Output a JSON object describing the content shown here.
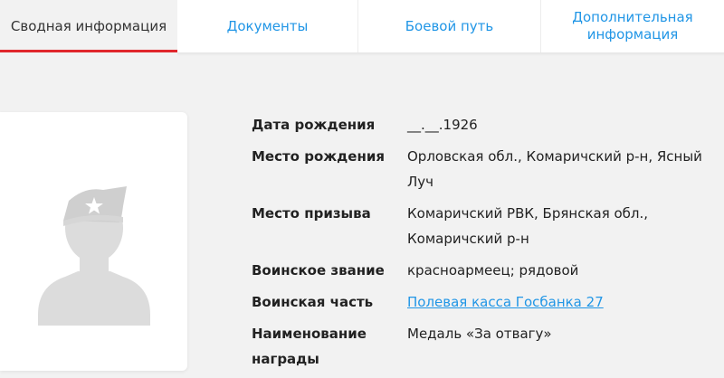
{
  "tabs": [
    {
      "label": "Сводная информация"
    },
    {
      "label": "Документы"
    },
    {
      "label": "Боевой путь"
    },
    {
      "label": "Дополнительная информация"
    }
  ],
  "person": {
    "fields": [
      {
        "label": "Дата рождения",
        "value": "__.__.1926"
      },
      {
        "label": "Место рождения",
        "value": "Орловская обл., Комаричский р-н, Ясный Луч"
      },
      {
        "label": "Место призыва",
        "value": "Комаричский РВК, Брянская обл., Комаричский р-н"
      },
      {
        "label": "Воинское звание",
        "value": "красноармеец; рядовой"
      },
      {
        "label": "Воинская часть",
        "value": "Полевая касса Госбанка 27"
      },
      {
        "label": "Наименование награды",
        "value": "Медаль «За отвагу»"
      }
    ]
  },
  "icons": {
    "photo": "soldier-silhouette-icon",
    "star": "star-icon"
  },
  "colors": {
    "accent": "#e0272d",
    "link": "#2196e6",
    "silhouette": "#dcdcdc"
  }
}
